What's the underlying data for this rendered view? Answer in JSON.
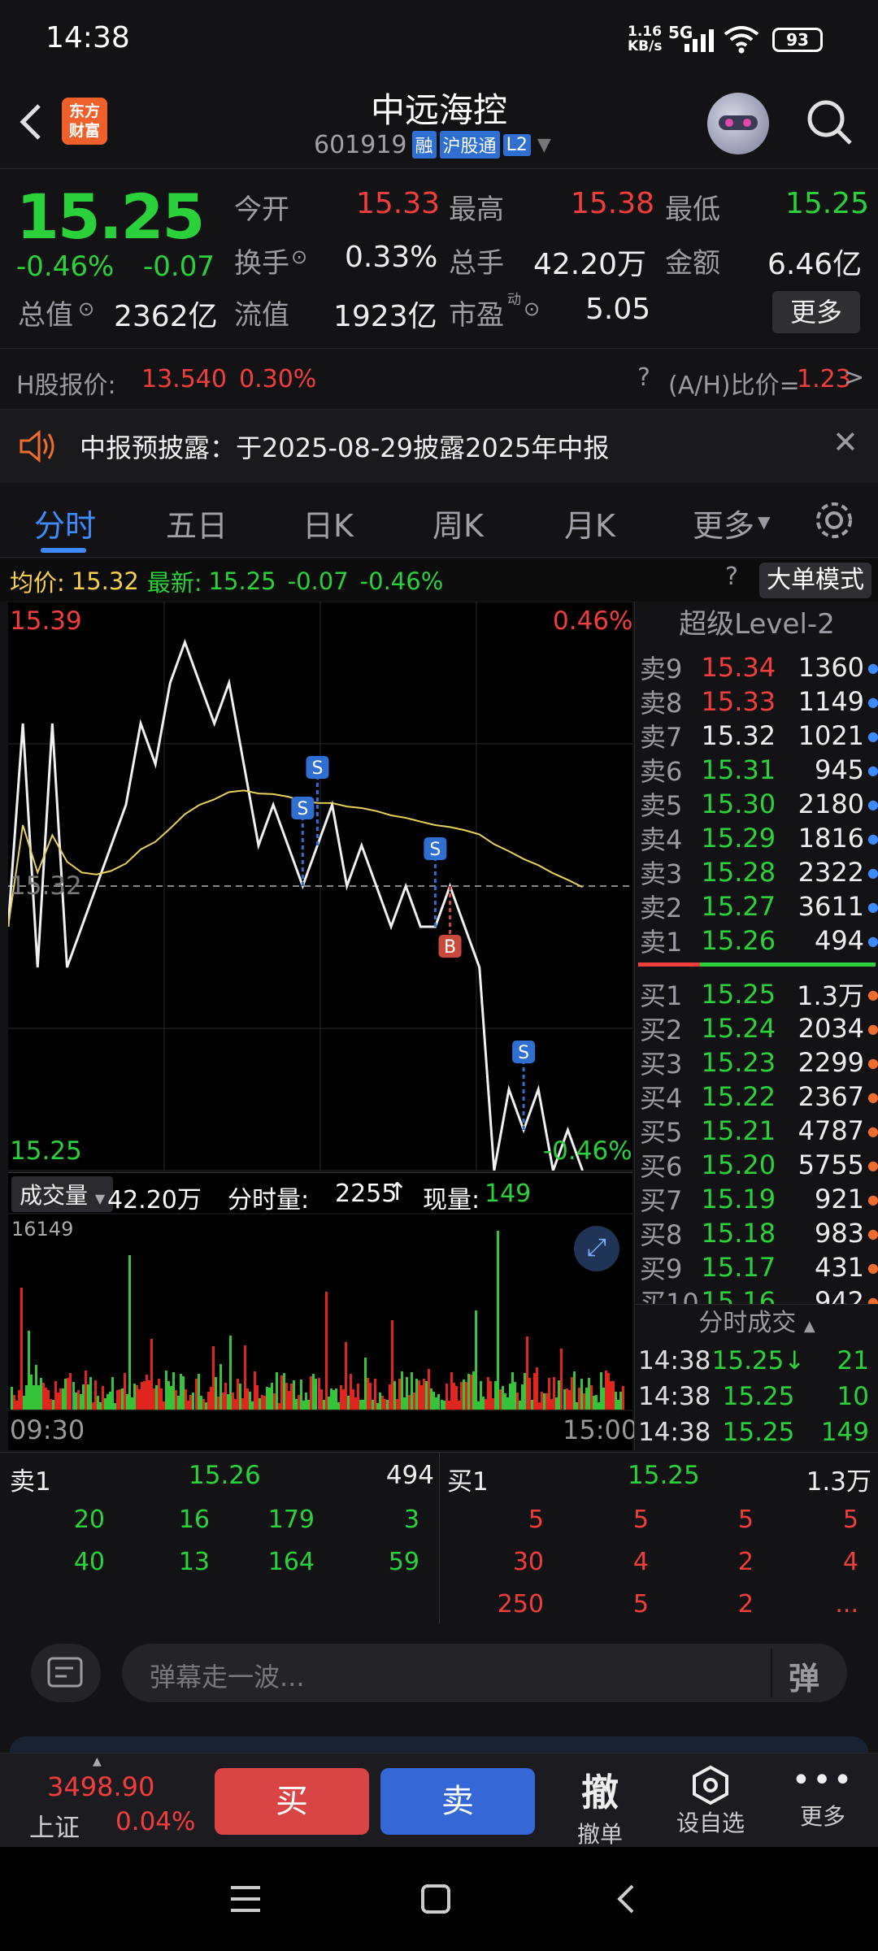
{
  "status": {
    "time": "14:38",
    "speed": "1.16\nKB/s",
    "net": "5G",
    "battery": "93"
  },
  "header": {
    "title": "中远海控",
    "code": "601919",
    "tags": [
      "融",
      "沪股通",
      "L2"
    ],
    "logo": "东方\n财富"
  },
  "quote": {
    "price": "15.25",
    "pct": "-0.46%",
    "chg": "-0.07",
    "open_lbl": "今开",
    "open": "15.33",
    "high_lbl": "最高",
    "high": "15.38",
    "low_lbl": "最低",
    "low": "15.25",
    "turnover_lbl": "换手",
    "turnover": "0.33%",
    "vol_lbl": "总手",
    "vol": "42.20万",
    "amt_lbl": "金额",
    "amt": "6.46亿",
    "mcap_lbl": "总值",
    "mcap": "2362亿",
    "float_lbl": "流值",
    "float": "1923亿",
    "pe_lbl": "市盈",
    "pe_sup": "动",
    "pe": "5.05",
    "more": "更多"
  },
  "hshare": {
    "label": "H股报价:",
    "price": "13.540",
    "pct": "0.30%",
    "ah_label": "(A/H)比价=",
    "ah": "1.23"
  },
  "notice": {
    "text": "中报预披露：于2025-08-29披露2025年中报"
  },
  "tabs": [
    "分时",
    "五日",
    "日K",
    "周K",
    "月K",
    "更多"
  ],
  "infobar": {
    "avg_lbl": "均价:",
    "avg": "15.32",
    "last_lbl": "最新:",
    "last": "15.25",
    "chg": "-0.07",
    "pct": "-0.46%",
    "mode": "大单模式"
  },
  "chart": {
    "top_price": "15.39",
    "top_pct": "0.46%",
    "mid_price": "15.32",
    "bot_price": "15.25",
    "bot_pct": "-0.46%",
    "vol_lbl": "成交量",
    "vol_total": "42.20万",
    "seg_lbl": "分时量:",
    "seg": "2255",
    "cur_lbl": "现量:",
    "cur": "149",
    "vol_max": "16149",
    "start": "09:30",
    "end": "15:00"
  },
  "chart_data": {
    "type": "line",
    "series": [
      {
        "values": [
          15.31,
          15.36,
          15.3,
          15.36,
          15.3,
          15.31,
          15.32,
          15.33,
          15.34,
          15.36,
          15.35,
          15.37,
          15.38,
          15.37,
          15.36,
          15.37,
          15.35,
          15.33,
          15.34,
          15.33,
          15.32,
          15.33,
          15.34,
          15.32,
          15.33,
          15.32,
          15.31,
          15.32,
          15.31,
          15.31,
          15.32,
          15.31,
          15.3,
          15.25,
          15.27,
          15.26,
          15.27,
          15.25,
          15.26,
          15.25
        ]
      }
    ],
    "ylim": [
      15.25,
      15.39
    ]
  },
  "level2": {
    "title": "超级Level-2",
    "asks": [
      [
        "卖9",
        "15.34",
        "1360"
      ],
      [
        "卖8",
        "15.33",
        "1149"
      ],
      [
        "卖7",
        "15.32",
        "1021"
      ],
      [
        "卖6",
        "15.31",
        "945"
      ],
      [
        "卖5",
        "15.30",
        "2180"
      ],
      [
        "卖4",
        "15.29",
        "1816"
      ],
      [
        "卖3",
        "15.28",
        "2322"
      ],
      [
        "卖2",
        "15.27",
        "3611"
      ],
      [
        "卖1",
        "15.26",
        "494"
      ]
    ],
    "bids": [
      [
        "买1",
        "15.25",
        "1.3万"
      ],
      [
        "买2",
        "15.24",
        "2034"
      ],
      [
        "买3",
        "15.23",
        "2299"
      ],
      [
        "买4",
        "15.22",
        "2367"
      ],
      [
        "买5",
        "15.21",
        "4787"
      ],
      [
        "买6",
        "15.20",
        "5755"
      ],
      [
        "买7",
        "15.19",
        "921"
      ],
      [
        "买8",
        "15.18",
        "983"
      ],
      [
        "买9",
        "15.17",
        "431"
      ],
      [
        "买10",
        "15.16",
        "942"
      ]
    ],
    "ticks_title": "分时成交",
    "ticks": [
      [
        "14:38",
        "15.25↓",
        "21"
      ],
      [
        "14:38",
        "15.25",
        "10"
      ],
      [
        "14:38",
        "15.25",
        "149"
      ]
    ]
  },
  "queue": {
    "ask_lbl": "卖1",
    "ask_price": "15.26",
    "ask_vol": "494",
    "bid_lbl": "买1",
    "bid_price": "15.25",
    "bid_vol": "1.3万",
    "ask_rows": [
      [
        "20",
        "16",
        "179",
        "3"
      ],
      [
        "40",
        "13",
        "164",
        "59"
      ]
    ],
    "bid_rows": [
      [
        "5",
        "5",
        "5",
        "5"
      ],
      [
        "30",
        "4",
        "2",
        "4"
      ],
      [
        "250",
        "5",
        "2",
        "..."
      ]
    ]
  },
  "danmu": {
    "placeholder": "弹幕走一波..."
  },
  "bottom": {
    "index": "3498.90",
    "index_name": "上证",
    "index_pct": "0.04%",
    "buy": "买",
    "sell": "卖",
    "cancel_icon": "撤",
    "cancel": "撤单",
    "watch": "设自选",
    "more": "更多"
  }
}
